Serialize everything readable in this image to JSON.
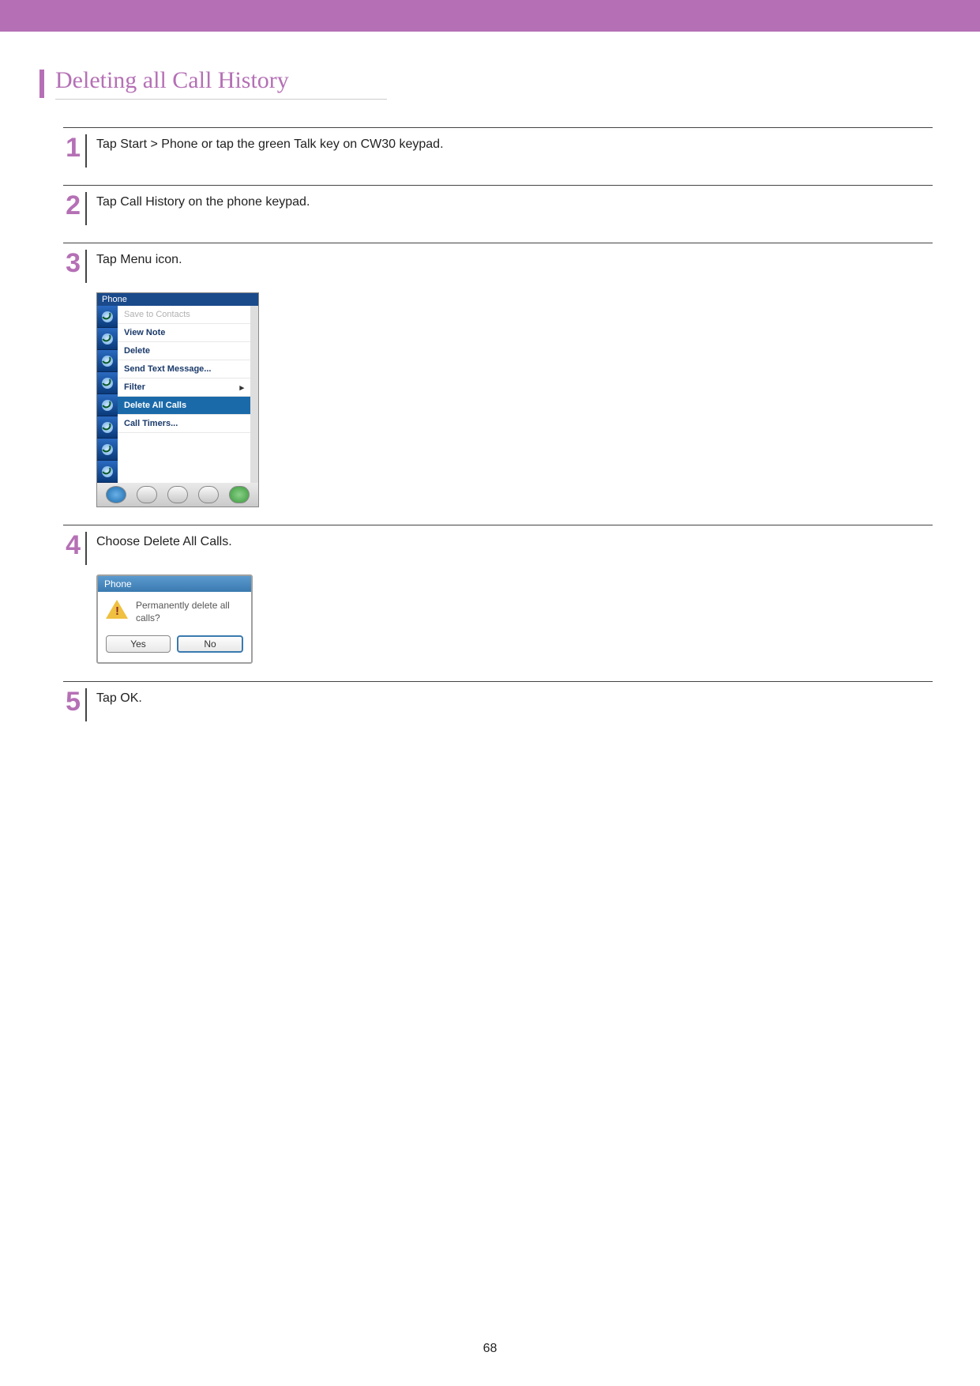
{
  "header": {
    "title": "Deleting all Call History"
  },
  "steps": [
    {
      "num": "1",
      "text": "Tap Start > Phone or tap the green Talk key on CW30 keypad."
    },
    {
      "num": "2",
      "text": "Tap Call History on the phone keypad."
    },
    {
      "num": "3",
      "text": "Tap Menu icon."
    },
    {
      "num": "4",
      "text": "Choose Delete All Calls."
    },
    {
      "num": "5",
      "text": "Tap OK."
    }
  ],
  "screenshot1": {
    "titlebar_left": "Phone",
    "menu": {
      "save_to_contacts": "Save to Contacts",
      "view_note": "View Note",
      "delete": "Delete",
      "send_text": "Send Text Message...",
      "filter": "Filter",
      "delete_all": "Delete All Calls",
      "call_timers": "Call Timers..."
    }
  },
  "screenshot2": {
    "titlebar": "Phone",
    "message": "Permanently delete all calls?",
    "yes": "Yes",
    "no": "No"
  },
  "page_number": "68"
}
